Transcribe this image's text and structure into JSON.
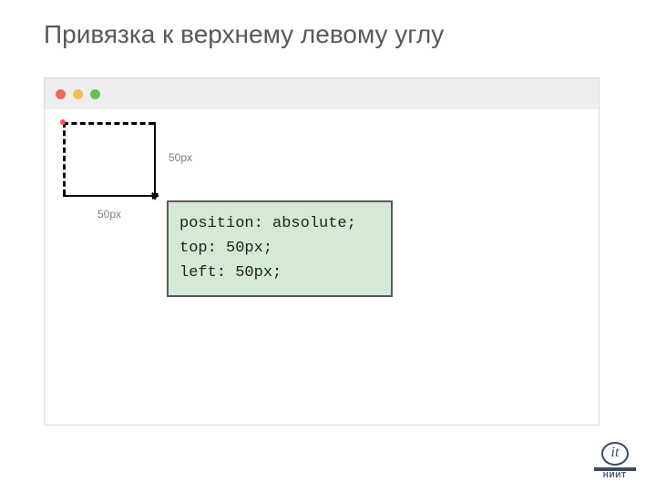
{
  "title": "Привязка к верхнему левому углу",
  "labels": {
    "vertical": "50px",
    "horizontal": "50px"
  },
  "code": {
    "line1": "position: absolute;",
    "line2": "top: 50px;",
    "line3": "left: 50px;"
  },
  "logo": {
    "mark": "it",
    "text": "НИИТ"
  }
}
